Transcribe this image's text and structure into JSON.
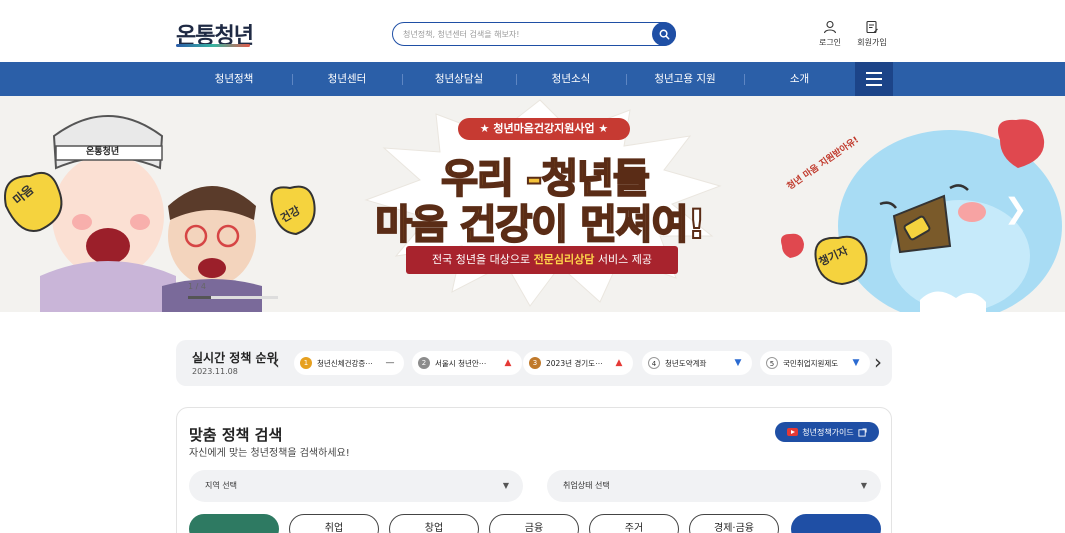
{
  "header": {
    "logo": "온통청년",
    "search_placeholder": "청년정책, 청년센터 검색을 해보자!",
    "login_label": "로그인",
    "join_label": "회원가입"
  },
  "nav": {
    "items": [
      "청년정책",
      "청년센터",
      "청년상담실",
      "청년소식",
      "청년고용 지원",
      "소개"
    ]
  },
  "banner": {
    "badge": "★ 청년마음건강지원사업 ★",
    "title_line1": "우리 -청년들",
    "title_line2_part1": "마음 건강",
    "title_line2_part2": "이 먼져여!",
    "ribbon_part1": "전국 청년을 대상으로 ",
    "ribbon_highlight": "전문심리상담",
    "ribbon_part2": " 서비스 제공",
    "sign_left1": "마음",
    "sign_left2": "건강",
    "sign_right": "챙기자",
    "headband": "온통청년",
    "curved_text": "청년 마음 지원받아유!",
    "page_counter": "1 / 4",
    "progress_fraction": 0.25,
    "colors": {
      "badge": "#c63a32",
      "title": "#f4c23a",
      "ribbon": "#a8232d"
    }
  },
  "ranking": {
    "title": "실시간 정책 순위",
    "date": "2023.11.08",
    "items": [
      {
        "num": "1",
        "name": "청년신체건강증⋯",
        "trend": "—",
        "trend_color": "#333333",
        "num_bg": "#e6a020"
      },
      {
        "num": "2",
        "name": "서울시 청년안⋯",
        "trend": "▲",
        "trend_color": "#e53935",
        "num_bg": "#8c8c8c"
      },
      {
        "num": "3",
        "name": "2023년 경기도⋯",
        "trend": "▲",
        "trend_color": "#e53935",
        "num_bg": "#c07a2c"
      },
      {
        "num": "4",
        "name": "청년도약계좌",
        "trend": "▼",
        "trend_color": "#2b6bd1",
        "num_bg": "#ffffff"
      },
      {
        "num": "5",
        "name": "국민취업지원제도",
        "trend": "▼",
        "trend_color": "#2b6bd1",
        "num_bg": "#ffffff"
      }
    ]
  },
  "match": {
    "title": "맞춤 정책 검색",
    "subtitle": "자신에게 맞는 청년정책을 검색하세요!",
    "guide_label": "청년정책가이드",
    "region_select": "지역 선택",
    "employment_select": "취업상태 선택",
    "categories": [
      "",
      "취업",
      "창업",
      "금융",
      "주거",
      "경제·금융",
      ""
    ]
  }
}
